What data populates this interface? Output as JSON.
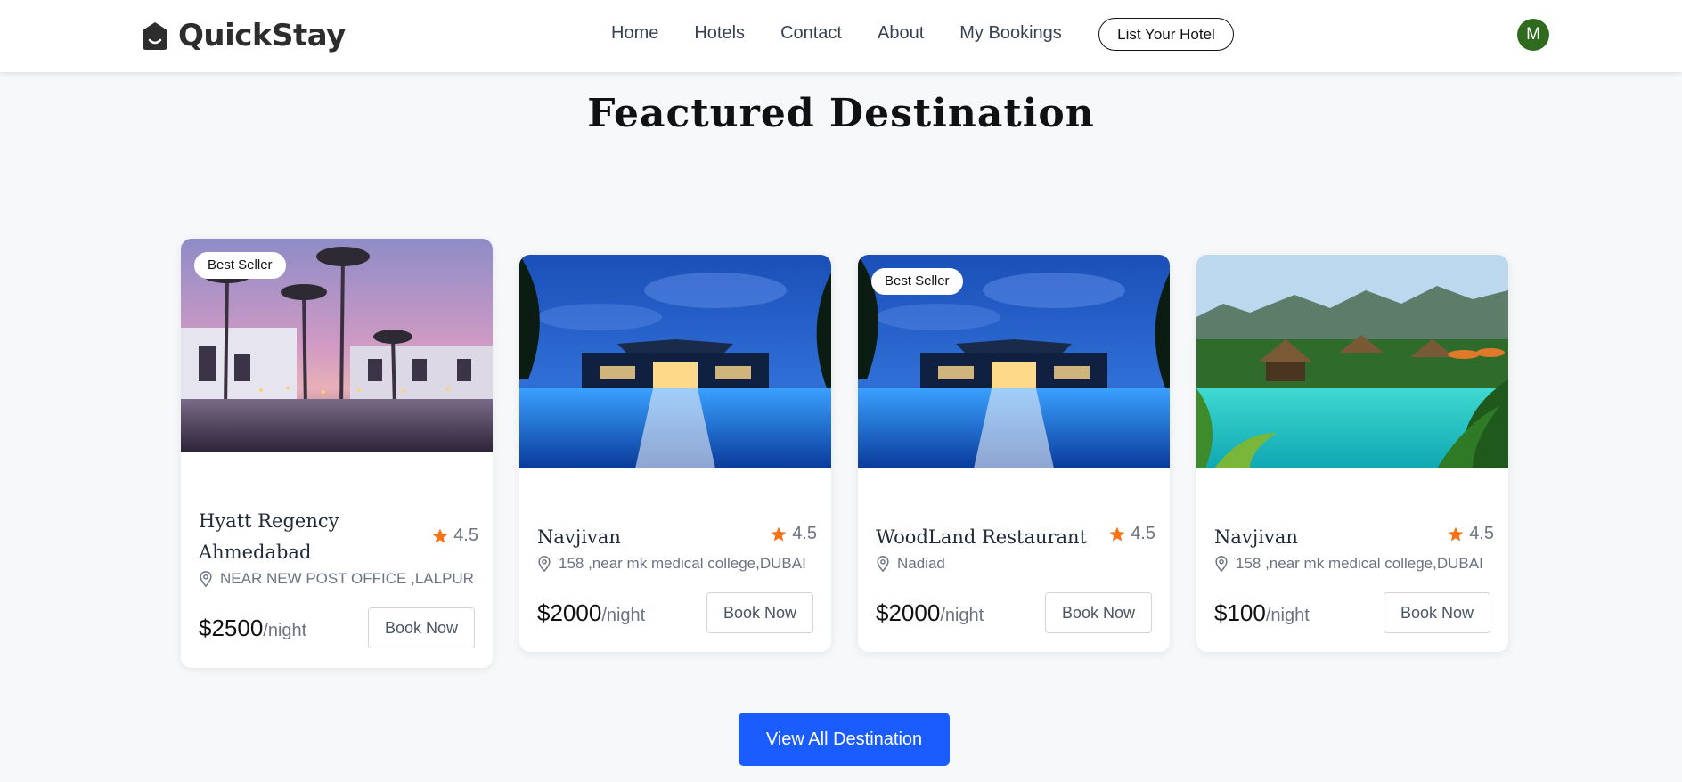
{
  "nav": {
    "brand": "QuickStay",
    "links": [
      "Home",
      "Hotels",
      "Contact",
      "About",
      "My Bookings"
    ],
    "list_hotel": "List Your Hotel",
    "avatar_initial": "M"
  },
  "section": {
    "title": "Feactured Destination"
  },
  "hotels": [
    {
      "badge": "Best Seller",
      "name": "Hyatt Regency Ahmedabad",
      "rating": "4.5",
      "address": "NEAR NEW POST OFFICE ,LALPUR",
      "price": "$2500",
      "per_night": "/night",
      "book_label": "Book Now",
      "image": "sunset-palm-resort"
    },
    {
      "badge": "",
      "name": "Navjivan",
      "rating": "4.5",
      "address": "158 ,near mk medical college,DUBAI",
      "price": "$2000",
      "per_night": "/night",
      "book_label": "Book Now",
      "image": "night-pool-villa"
    },
    {
      "badge": "Best Seller",
      "name": "WoodLand Restaurant",
      "rating": "4.5",
      "address": "Nadiad",
      "price": "$2000",
      "per_night": "/night",
      "book_label": "Book Now",
      "image": "night-pool-villa"
    },
    {
      "badge": "",
      "name": "Navjivan",
      "rating": "4.5",
      "address": "158 ,near mk medical college,DUBAI",
      "price": "$100",
      "per_night": "/night",
      "book_label": "Book Now",
      "image": "tropical-pool-resort"
    }
  ],
  "cta": {
    "label": "View All Destination"
  },
  "colors": {
    "accent": "#1a5cff",
    "star": "#f97316",
    "avatar": "#2f6a1f"
  }
}
